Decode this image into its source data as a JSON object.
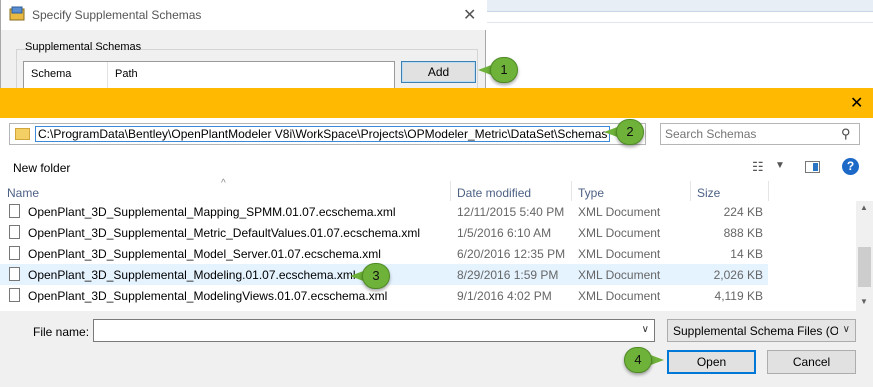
{
  "small_dialog": {
    "title": "Specify Supplemental Schemas",
    "group_label": "Supplemental Schemas",
    "columns": [
      "Schema",
      "Path"
    ],
    "add_label": "Add"
  },
  "callouts": [
    "1",
    "2",
    "3",
    "4"
  ],
  "file_dialog": {
    "address_path": "C:\\ProgramData\\Bentley\\OpenPlantModeler V8i\\WorkSpace\\Projects\\OPModeler_Metric\\DataSet\\Schemas",
    "search_placeholder": "Search Schemas",
    "new_folder_label": "New folder",
    "columns": {
      "name": "Name",
      "date": "Date modified",
      "type": "Type",
      "size": "Size"
    },
    "files": [
      {
        "name": "OpenPlant_3D_Supplemental_Mapping_SPMM.01.07.ecschema.xml",
        "date": "12/11/2015 5:40 PM",
        "type": "XML Document",
        "size": "224 KB"
      },
      {
        "name": "OpenPlant_3D_Supplemental_Metric_DefaultValues.01.07.ecschema.xml",
        "date": "1/5/2016 6:10 AM",
        "type": "XML Document",
        "size": "888 KB"
      },
      {
        "name": "OpenPlant_3D_Supplemental_Model_Server.01.07.ecschema.xml",
        "date": "6/20/2016 12:35 PM",
        "type": "XML Document",
        "size": "14 KB"
      },
      {
        "name": "OpenPlant_3D_Supplemental_Modeling.01.07.ecschema.xml",
        "date": "8/29/2016 1:59 PM",
        "type": "XML Document",
        "size": "2,026 KB"
      },
      {
        "name": "OpenPlant_3D_Supplemental_ModelingViews.01.07.ecschema.xml",
        "date": "9/1/2016 4:02 PM",
        "type": "XML Document",
        "size": "4,119 KB"
      }
    ],
    "selected_index": 3,
    "file_name_label": "File name:",
    "file_name_value": "",
    "filter_value": "Supplemental Schema Files (Op",
    "open_label": "Open",
    "cancel_label": "Cancel"
  },
  "colors": {
    "title_bar": "#ffb900",
    "callout": "#6fb23a",
    "selection": "#e5f3ff",
    "accent": "#0078d7"
  }
}
